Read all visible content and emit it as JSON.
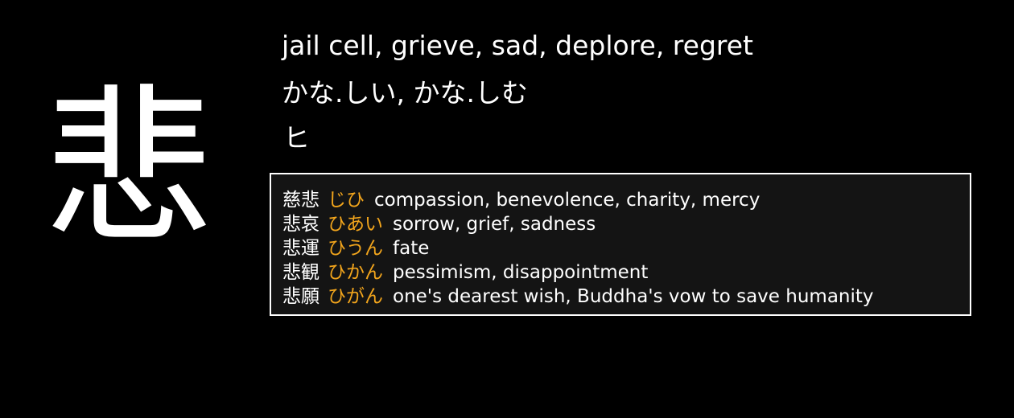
{
  "kanji": {
    "character": "悲",
    "meanings": "jail cell, grieve, sad, deplore, regret",
    "kun_readings": "かな.しい, かな.しむ",
    "on_readings": "ヒ"
  },
  "vocabulary": [
    {
      "word": "慈悲",
      "reading": "じひ",
      "meaning": "compassion, benevolence, charity, mercy"
    },
    {
      "word": "悲哀",
      "reading": "ひあい",
      "meaning": "sorrow, grief, sadness"
    },
    {
      "word": "悲運",
      "reading": "ひうん",
      "meaning": "fate"
    },
    {
      "word": "悲観",
      "reading": "ひかん",
      "meaning": "pessimism, disappointment"
    },
    {
      "word": "悲願",
      "reading": "ひがん",
      "meaning": "one's dearest wish, Buddha's vow to save humanity"
    }
  ],
  "colors": {
    "background": "#000000",
    "text": "#ffffff",
    "reading_accent": "#f2a51c",
    "vocab_panel": "#141414",
    "vocab_border": "#ffffff"
  }
}
